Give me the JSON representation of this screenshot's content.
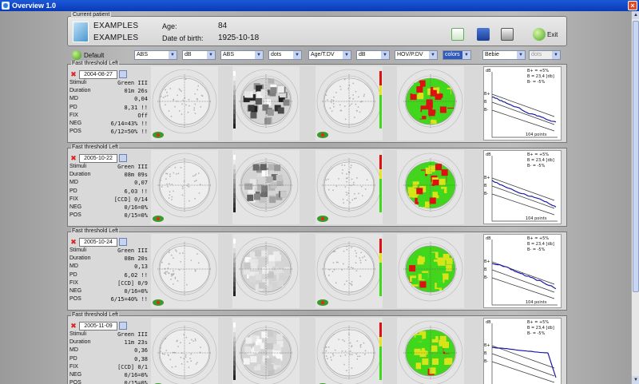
{
  "window": {
    "title": "Overview 1.0",
    "close": "×"
  },
  "patient": {
    "legend": "Current patient",
    "last_name": "EXAMPLES",
    "first_name": "EXAMPLES",
    "age_label": "Age:",
    "age_value": "84",
    "dob_label": "Date of birth:",
    "dob_value": "1925-10-18",
    "exit_label": "Exit"
  },
  "toolbar": {
    "default_label": "Default",
    "selects": [
      "ABS",
      "dB",
      "ABS",
      "dots",
      "Age/T.DV",
      "dB",
      "HOV/P.DV",
      "colors",
      "Bebie",
      "dots"
    ]
  },
  "tests": [
    {
      "header": "Fast threshold   Left",
      "date": "2004-08-27",
      "stats": [
        [
          "Stimuli",
          "Green III"
        ],
        [
          "Duration",
          "01m 26s"
        ],
        [
          "MD",
          "0,04"
        ],
        [
          "PD",
          "8,31 !!"
        ],
        [
          "FIX",
          "Off"
        ],
        [
          "NEG",
          "6/14=43% !!"
        ],
        [
          "POS",
          "6/12=50% !!"
        ]
      ]
    },
    {
      "header": "Fast threshold   Left",
      "date": "2005-10-22",
      "stats": [
        [
          "Stimuli",
          "Green III"
        ],
        [
          "Duration",
          "08m 09s"
        ],
        [
          "MD",
          "0,07"
        ],
        [
          "PD",
          "6,03 !!"
        ],
        [
          "FIX",
          "[CCD]  0/14"
        ],
        [
          "NEG",
          "0/16=0%"
        ],
        [
          "POS",
          "0/15=0%"
        ]
      ]
    },
    {
      "header": "Fast threshold   Left",
      "date": "2005-10-24",
      "stats": [
        [
          "Stimuli",
          "Green III"
        ],
        [
          "Duration",
          "08m 20s"
        ],
        [
          "MD",
          "0,13"
        ],
        [
          "PD",
          "6,02 !!"
        ],
        [
          "FIX",
          "[CCD]  0/9"
        ],
        [
          "NEG",
          "0/16=0%"
        ],
        [
          "POS",
          "6/15=40% !!"
        ]
      ]
    },
    {
      "header": "Fast threshold   Left",
      "date": "2005-11-09",
      "stats": [
        [
          "Stimuli",
          "Green III"
        ],
        [
          "Duration",
          "11m 23s"
        ],
        [
          "MD",
          "0,36"
        ],
        [
          "PD",
          "0,38"
        ],
        [
          "FIX",
          "[CCD]  0/1"
        ],
        [
          "NEG",
          "0/16=0%"
        ],
        [
          "POS",
          "0/15=0%"
        ]
      ]
    }
  ],
  "graph_labels": {
    "b_plus": "B+ = +5%",
    "b": "B  = 23,4 [db]",
    "b_minus": "B- = -5%",
    "db": "dB",
    "points": "104 points",
    "bp": "B+",
    "bm": "B-",
    "bb": "B"
  },
  "colors": {
    "title_bar": "#0a3bb6",
    "green": "#3ed81c",
    "red": "#e01010",
    "yellow": "#e6e61a"
  }
}
